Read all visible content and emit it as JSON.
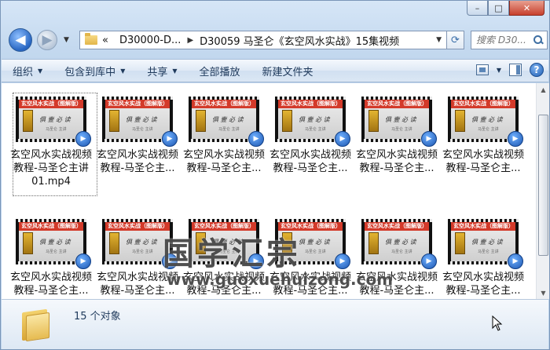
{
  "window": {
    "caption": {
      "minimize": "–",
      "maximize": "□",
      "close": "✕"
    }
  },
  "nav": {
    "back_icon": "◀",
    "forward_icon": "▶",
    "breadcrumbs": [
      "«",
      "D30000-D...",
      "D30059 马圣仑《玄空风水实战》15集视频"
    ],
    "refresh_icon": "⟳",
    "search_placeholder": "搜索 D30..."
  },
  "toolbar": {
    "items": [
      {
        "label": "组织",
        "dropdown": true
      },
      {
        "label": "包含到库中",
        "dropdown": true
      },
      {
        "label": "共享",
        "dropdown": true
      },
      {
        "label": "全部播放",
        "dropdown": false
      },
      {
        "label": "新建文件夹",
        "dropdown": false
      }
    ],
    "help_label": "?"
  },
  "thumbnail": {
    "banner": "玄空风水实战（图解版）",
    "subtitle": "俱 壹 必 读",
    "credit": "马圣仑  主讲"
  },
  "files": [
    {
      "line1": "玄空风水实战视频",
      "line2": "教程-马圣仑主讲",
      "line3": "01.mp4",
      "focused": true
    },
    {
      "line1": "玄空风水实战视频",
      "line2": "教程-马圣仑主..."
    },
    {
      "line1": "玄空风水实战视频",
      "line2": "教程-马圣仑主..."
    },
    {
      "line1": "玄空风水实战视频",
      "line2": "教程-马圣仑主..."
    },
    {
      "line1": "玄空风水实战视频",
      "line2": "教程-马圣仑主..."
    },
    {
      "line1": "玄空风水实战视频",
      "line2": "教程-马圣仑主..."
    },
    {
      "line1": "玄空风水实战视频",
      "line2": "教程-马圣仑主..."
    },
    {
      "line1": "玄空风水实战视频",
      "line2": "教程-马圣仑主..."
    },
    {
      "line1": "玄空风水实战视频",
      "line2": "教程-马圣仑主..."
    },
    {
      "line1": "玄空风水实战视频",
      "line2": "教程-马圣仑主..."
    },
    {
      "line1": "玄空风水实战视频",
      "line2": "教程-马圣仑主..."
    },
    {
      "line1": "玄空风水实战视频",
      "line2": "教程-马圣仑主..."
    }
  ],
  "watermark": {
    "title": "国学汇宗",
    "url": "www.guoxuehuizong.com"
  },
  "status": {
    "count_text": "15 个对象"
  },
  "colors": {
    "accent": "#1e395b",
    "banner_red": "#d33a2a",
    "close_red": "#c7402d"
  }
}
